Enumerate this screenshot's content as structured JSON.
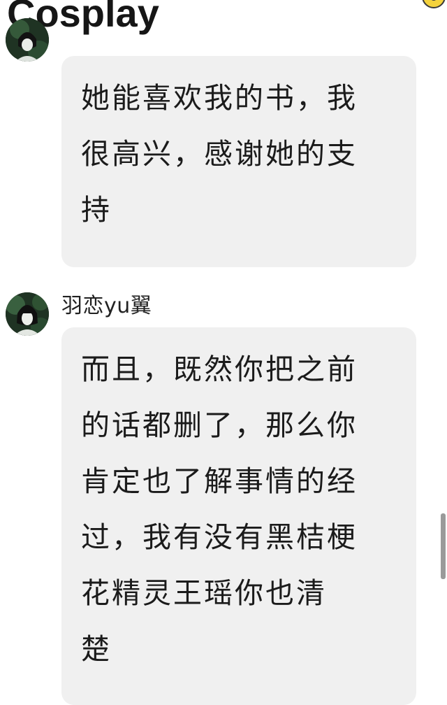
{
  "header": {
    "title": "Cosplay",
    "emoji_icon": "face-emoji-icon"
  },
  "messages": [
    {
      "avatar_icon": "user-avatar-icon",
      "lines": [
        "她能喜欢我的书，我",
        "很高兴，感谢她的支",
        "持"
      ]
    },
    {
      "username": "羽恋yu翼",
      "avatar_icon": "user-avatar-icon",
      "lines": [
        "而且，既然你把之前",
        "的话都删了，那么你",
        "肯定也了解事情的经",
        "过，我有没有黑桔梗",
        "花精灵王瑶你也清",
        "楚"
      ]
    }
  ],
  "colors": {
    "bubble_background": "#f0f0f0",
    "text": "#1b1b1b",
    "scrollbar": "#9a9a9a"
  }
}
